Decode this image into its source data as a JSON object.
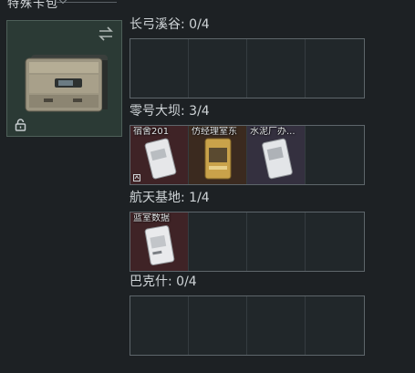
{
  "header": {
    "title": "特殊卡包"
  },
  "case": {
    "name": "case-item",
    "locked": true
  },
  "regions": [
    {
      "title": "长弓溪谷: 0/4",
      "slots": [
        null,
        null,
        null,
        null
      ]
    },
    {
      "title": "零号大坝: 3/4",
      "slots": [
        {
          "label": "宿舍201",
          "color": "red"
        },
        {
          "label": "仿经理室东",
          "color": "gold"
        },
        {
          "label": "水泥厂办...",
          "color": "purple"
        },
        null
      ]
    },
    {
      "title": "航天基地: 1/4",
      "slots": [
        {
          "label": "蓝室数据",
          "color": "red"
        },
        null,
        null,
        null
      ]
    },
    {
      "title": "巴克什: 0/4",
      "slots": [
        null,
        null,
        null,
        null
      ]
    }
  ],
  "colors": {
    "background": "#1d2124",
    "case_card": "#2b3a35",
    "slot_red": "#3f2326",
    "slot_gold": "#3b2a1f",
    "slot_purple": "#34303f"
  }
}
